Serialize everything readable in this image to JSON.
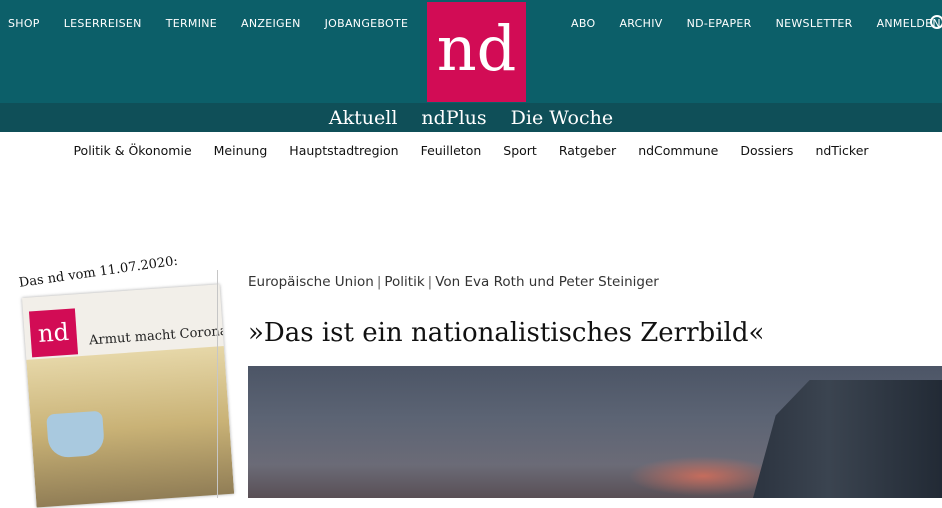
{
  "header": {
    "left_nav": [
      "SHOP",
      "LESERREISEN",
      "TERMINE",
      "ANZEIGEN",
      "JOBANGEBOTE"
    ],
    "right_nav": [
      "ABO",
      "ARCHIV",
      "ND-EPAPER",
      "NEWSLETTER",
      "ANMELDEN"
    ],
    "logo_text": "nd",
    "search_icon": "search-icon"
  },
  "sections": [
    "Aktuell",
    "ndPlus",
    "Die Woche"
  ],
  "categories": [
    "Politik & Ökonomie",
    "Meinung",
    "Hauptstadtregion",
    "Feuilleton",
    "Sport",
    "Ratgeber",
    "ndCommune",
    "Dossiers",
    "ndTicker"
  ],
  "sidebar": {
    "promo_label": "Das nd vom 11.07.2020:",
    "cover_logo": "nd",
    "cover_headline": "Armut macht Corona"
  },
  "article": {
    "meta": {
      "category": "Europäische Union",
      "section": "Politik",
      "authors": "Von Eva Roth und Peter Steiniger"
    },
    "title": "»Das ist ein nationalistisches Zerrbild«"
  },
  "colors": {
    "header_bg": "#0c5f69",
    "section_bar_bg": "#0f4f58",
    "logo_bg": "#d20c55"
  }
}
